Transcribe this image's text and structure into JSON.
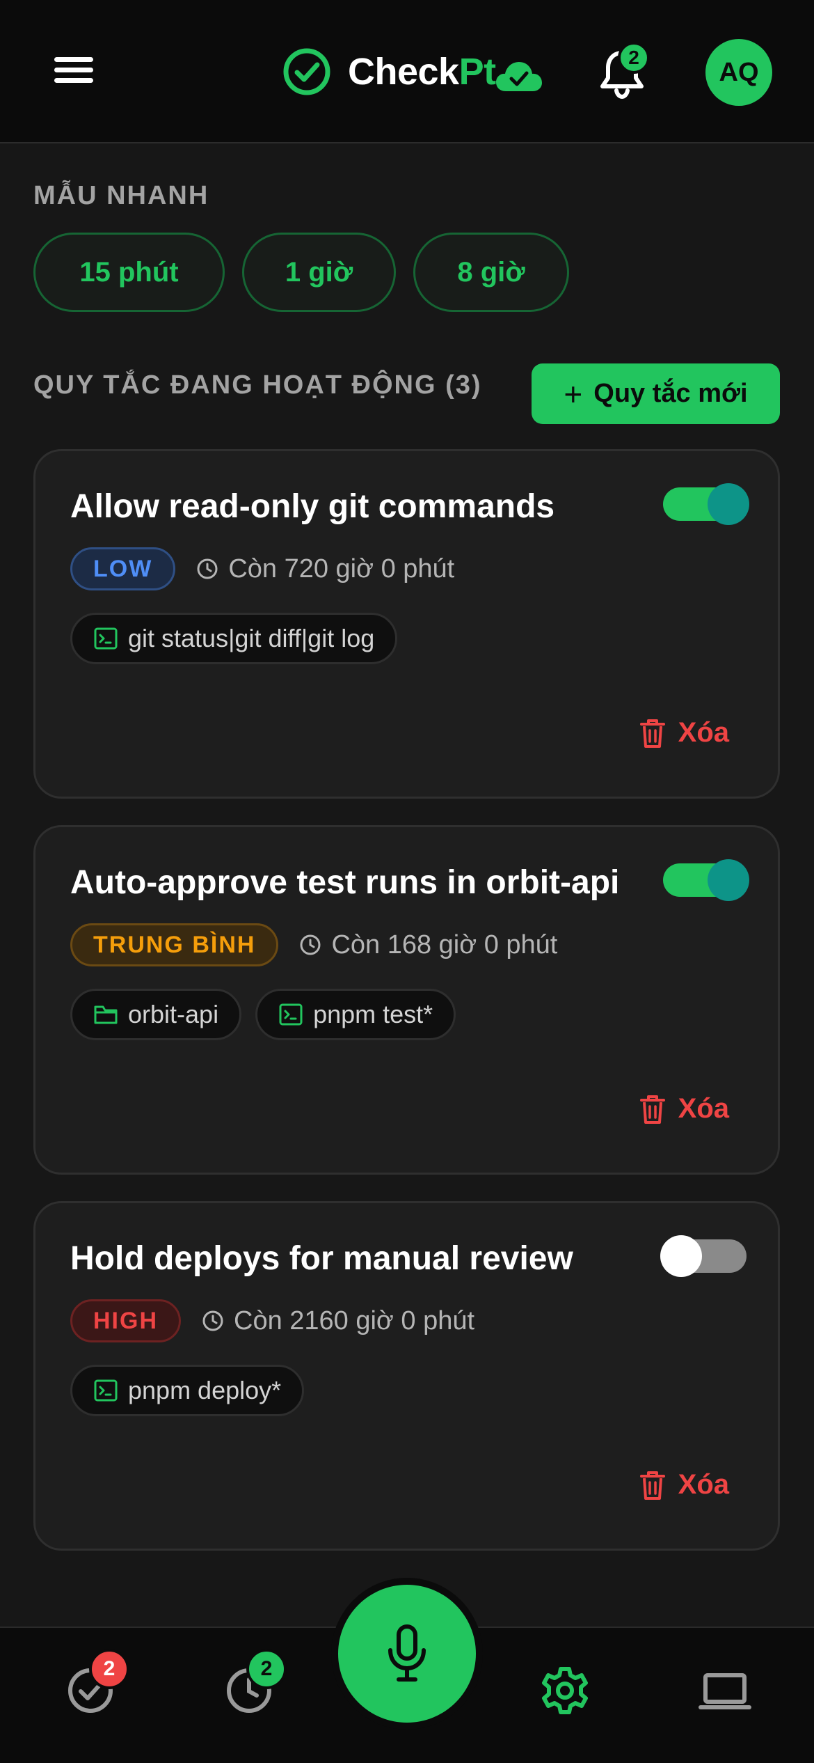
{
  "app": {
    "logo_part1": "Check",
    "logo_part2": "Pt",
    "notification_count": "2",
    "avatar_initials": "AQ"
  },
  "quick_templates": {
    "label": "MẪU NHANH",
    "items": [
      "15 phút",
      "1 giờ",
      "8 giờ"
    ]
  },
  "active_rules": {
    "label": "QUY TẮC ĐANG HOẠT ĐỘNG (3)",
    "new_rule_label": "Quy tắc mới"
  },
  "rules": [
    {
      "title": "Allow read-only git commands",
      "enabled": true,
      "risk": "LOW",
      "risk_color": "#4f8ef7",
      "remaining": "Còn 720 giờ 0 phút",
      "tags": [
        {
          "icon": "terminal-icon",
          "text": "git status|git diff|git log"
        }
      ],
      "delete_label": "Xóa"
    },
    {
      "title": "Auto-approve test runs in orbit-api",
      "enabled": true,
      "risk": "TRUNG BÌNH",
      "risk_color": "#f59e0b",
      "remaining": "Còn 168 giờ 0 phút",
      "tags": [
        {
          "icon": "folder-icon",
          "text": "orbit-api"
        },
        {
          "icon": "terminal-icon",
          "text": "pnpm test*"
        }
      ],
      "delete_label": "Xóa"
    },
    {
      "title": "Hold deploys for manual review",
      "enabled": false,
      "risk": "HIGH",
      "risk_color": "#ef4444",
      "remaining": "Còn 2160 giờ 0 phút",
      "tags": [
        {
          "icon": "terminal-icon",
          "text": "pnpm deploy*"
        }
      ],
      "delete_label": "Xóa"
    }
  ],
  "bottom_nav": {
    "approvals_badge": "2",
    "history_badge": "2",
    "accent": "#22c55e",
    "danger": "#ef4444"
  }
}
